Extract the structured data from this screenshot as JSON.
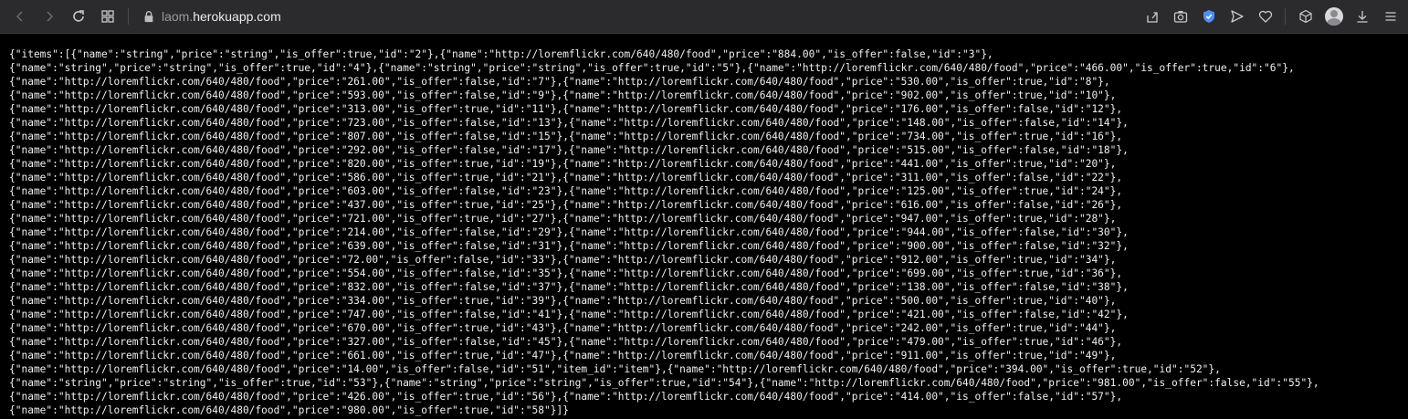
{
  "browser": {
    "url_prefix": "laom.",
    "url_host": "herokuapp.com",
    "icons": [
      "back-arrow-icon",
      "forward-arrow-icon",
      "reload-icon",
      "speed-dial-icon",
      "lock-icon",
      "share-icon",
      "camera-icon",
      "brave-shield-icon",
      "send-icon",
      "heart-icon",
      "cube-icon",
      "profile-avatar",
      "download-icon",
      "menu-icon"
    ],
    "accent_color": "#4d8ff5"
  },
  "json_lines": [
    "{\"items\":[{\"name\":\"string\",\"price\":\"string\",\"is_offer\":true,\"id\":\"2\"},{\"name\":\"http://loremflickr.com/640/480/food\",\"price\":\"884.00\",\"is_offer\":false,\"id\":\"3\"},",
    "{\"name\":\"string\",\"price\":\"string\",\"is_offer\":true,\"id\":\"4\"},{\"name\":\"string\",\"price\":\"string\",\"is_offer\":true,\"id\":\"5\"},{\"name\":\"http://loremflickr.com/640/480/food\",\"price\":\"466.00\",\"is_offer\":true,\"id\":\"6\"},",
    "{\"name\":\"http://loremflickr.com/640/480/food\",\"price\":\"261.00\",\"is_offer\":false,\"id\":\"7\"},{\"name\":\"http://loremflickr.com/640/480/food\",\"price\":\"530.00\",\"is_offer\":true,\"id\":\"8\"},",
    "{\"name\":\"http://loremflickr.com/640/480/food\",\"price\":\"593.00\",\"is_offer\":false,\"id\":\"9\"},{\"name\":\"http://loremflickr.com/640/480/food\",\"price\":\"902.00\",\"is_offer\":true,\"id\":\"10\"},",
    "{\"name\":\"http://loremflickr.com/640/480/food\",\"price\":\"313.00\",\"is_offer\":true,\"id\":\"11\"},{\"name\":\"http://loremflickr.com/640/480/food\",\"price\":\"176.00\",\"is_offer\":false,\"id\":\"12\"},",
    "{\"name\":\"http://loremflickr.com/640/480/food\",\"price\":\"723.00\",\"is_offer\":false,\"id\":\"13\"},{\"name\":\"http://loremflickr.com/640/480/food\",\"price\":\"148.00\",\"is_offer\":false,\"id\":\"14\"},",
    "{\"name\":\"http://loremflickr.com/640/480/food\",\"price\":\"807.00\",\"is_offer\":false,\"id\":\"15\"},{\"name\":\"http://loremflickr.com/640/480/food\",\"price\":\"734.00\",\"is_offer\":true,\"id\":\"16\"},",
    "{\"name\":\"http://loremflickr.com/640/480/food\",\"price\":\"292.00\",\"is_offer\":false,\"id\":\"17\"},{\"name\":\"http://loremflickr.com/640/480/food\",\"price\":\"515.00\",\"is_offer\":false,\"id\":\"18\"},",
    "{\"name\":\"http://loremflickr.com/640/480/food\",\"price\":\"820.00\",\"is_offer\":true,\"id\":\"19\"},{\"name\":\"http://loremflickr.com/640/480/food\",\"price\":\"441.00\",\"is_offer\":true,\"id\":\"20\"},",
    "{\"name\":\"http://loremflickr.com/640/480/food\",\"price\":\"586.00\",\"is_offer\":true,\"id\":\"21\"},{\"name\":\"http://loremflickr.com/640/480/food\",\"price\":\"311.00\",\"is_offer\":false,\"id\":\"22\"},",
    "{\"name\":\"http://loremflickr.com/640/480/food\",\"price\":\"603.00\",\"is_offer\":false,\"id\":\"23\"},{\"name\":\"http://loremflickr.com/640/480/food\",\"price\":\"125.00\",\"is_offer\":true,\"id\":\"24\"},",
    "{\"name\":\"http://loremflickr.com/640/480/food\",\"price\":\"437.00\",\"is_offer\":true,\"id\":\"25\"},{\"name\":\"http://loremflickr.com/640/480/food\",\"price\":\"616.00\",\"is_offer\":false,\"id\":\"26\"},",
    "{\"name\":\"http://loremflickr.com/640/480/food\",\"price\":\"721.00\",\"is_offer\":true,\"id\":\"27\"},{\"name\":\"http://loremflickr.com/640/480/food\",\"price\":\"947.00\",\"is_offer\":true,\"id\":\"28\"},",
    "{\"name\":\"http://loremflickr.com/640/480/food\",\"price\":\"214.00\",\"is_offer\":false,\"id\":\"29\"},{\"name\":\"http://loremflickr.com/640/480/food\",\"price\":\"944.00\",\"is_offer\":false,\"id\":\"30\"},",
    "{\"name\":\"http://loremflickr.com/640/480/food\",\"price\":\"639.00\",\"is_offer\":false,\"id\":\"31\"},{\"name\":\"http://loremflickr.com/640/480/food\",\"price\":\"900.00\",\"is_offer\":false,\"id\":\"32\"},",
    "{\"name\":\"http://loremflickr.com/640/480/food\",\"price\":\"72.00\",\"is_offer\":false,\"id\":\"33\"},{\"name\":\"http://loremflickr.com/640/480/food\",\"price\":\"912.00\",\"is_offer\":true,\"id\":\"34\"},",
    "{\"name\":\"http://loremflickr.com/640/480/food\",\"price\":\"554.00\",\"is_offer\":false,\"id\":\"35\"},{\"name\":\"http://loremflickr.com/640/480/food\",\"price\":\"699.00\",\"is_offer\":true,\"id\":\"36\"},",
    "{\"name\":\"http://loremflickr.com/640/480/food\",\"price\":\"832.00\",\"is_offer\":false,\"id\":\"37\"},{\"name\":\"http://loremflickr.com/640/480/food\",\"price\":\"138.00\",\"is_offer\":false,\"id\":\"38\"},",
    "{\"name\":\"http://loremflickr.com/640/480/food\",\"price\":\"334.00\",\"is_offer\":true,\"id\":\"39\"},{\"name\":\"http://loremflickr.com/640/480/food\",\"price\":\"500.00\",\"is_offer\":true,\"id\":\"40\"},",
    "{\"name\":\"http://loremflickr.com/640/480/food\",\"price\":\"747.00\",\"is_offer\":false,\"id\":\"41\"},{\"name\":\"http://loremflickr.com/640/480/food\",\"price\":\"421.00\",\"is_offer\":false,\"id\":\"42\"},",
    "{\"name\":\"http://loremflickr.com/640/480/food\",\"price\":\"670.00\",\"is_offer\":true,\"id\":\"43\"},{\"name\":\"http://loremflickr.com/640/480/food\",\"price\":\"242.00\",\"is_offer\":true,\"id\":\"44\"},",
    "{\"name\":\"http://loremflickr.com/640/480/food\",\"price\":\"327.00\",\"is_offer\":false,\"id\":\"45\"},{\"name\":\"http://loremflickr.com/640/480/food\",\"price\":\"479.00\",\"is_offer\":true,\"id\":\"46\"},",
    "{\"name\":\"http://loremflickr.com/640/480/food\",\"price\":\"661.00\",\"is_offer\":true,\"id\":\"47\"},{\"name\":\"http://loremflickr.com/640/480/food\",\"price\":\"911.00\",\"is_offer\":true,\"id\":\"49\"},",
    "{\"name\":\"http://loremflickr.com/640/480/food\",\"price\":\"14.00\",\"is_offer\":false,\"id\":\"51\",\"item_id\":\"item\"},{\"name\":\"http://loremflickr.com/640/480/food\",\"price\":\"394.00\",\"is_offer\":true,\"id\":\"52\"},",
    "{\"name\":\"string\",\"price\":\"string\",\"is_offer\":true,\"id\":\"53\"},{\"name\":\"string\",\"price\":\"string\",\"is_offer\":true,\"id\":\"54\"},{\"name\":\"http://loremflickr.com/640/480/food\",\"price\":\"981.00\",\"is_offer\":false,\"id\":\"55\"},",
    "{\"name\":\"http://loremflickr.com/640/480/food\",\"price\":\"426.00\",\"is_offer\":true,\"id\":\"56\"},{\"name\":\"http://loremflickr.com/640/480/food\",\"price\":\"414.00\",\"is_offer\":false,\"id\":\"57\"},",
    "{\"name\":\"http://loremflickr.com/640/480/food\",\"price\":\"980.00\",\"is_offer\":true,\"id\":\"58\"}]}"
  ]
}
